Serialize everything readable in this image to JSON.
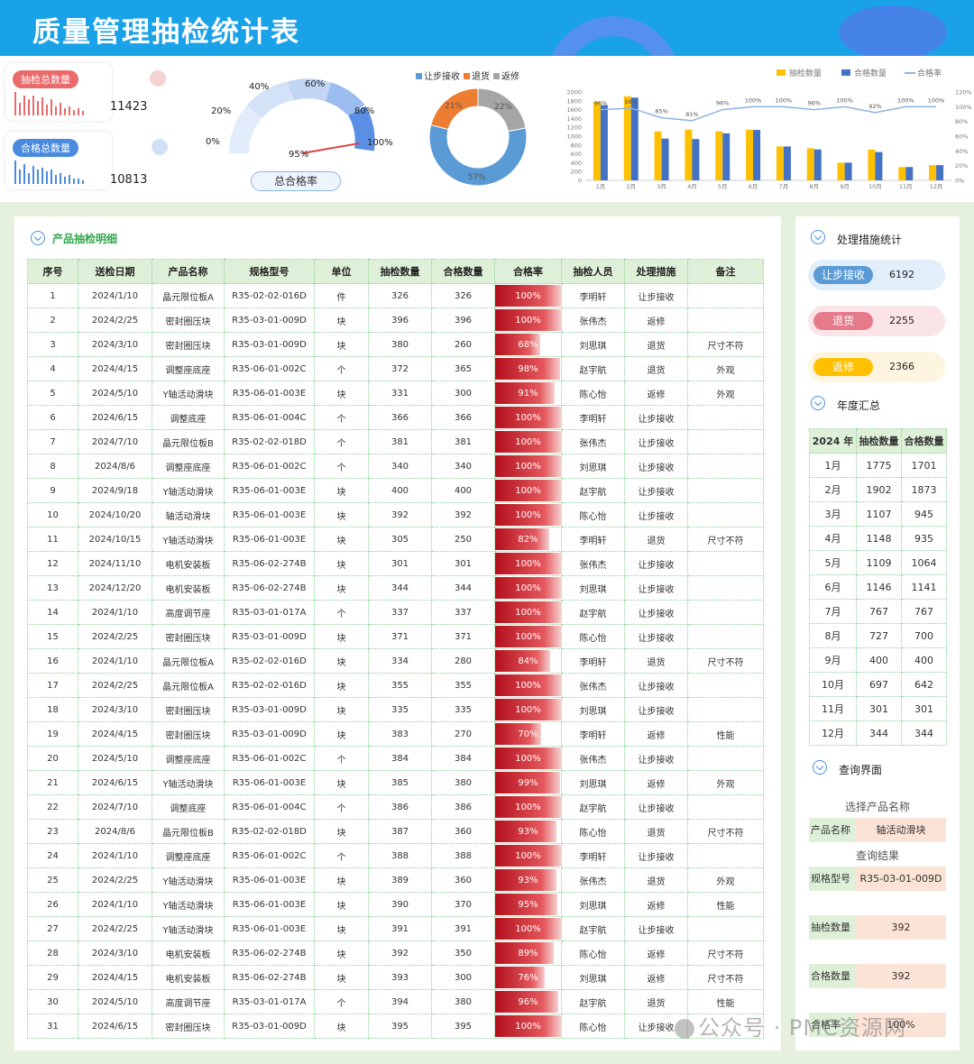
{
  "title": "质量管理抽检统计表",
  "kpis": {
    "inspected": {
      "label": "抽检总数量",
      "value": "11423",
      "color": "#e96b6b"
    },
    "qualified": {
      "label": "合格总数量",
      "value": "10813",
      "color": "#4a8be0"
    }
  },
  "gauge": {
    "title": "总合格率",
    "value_label": "95%",
    "value_fraction": 0.95,
    "ticks": [
      "0%",
      "20%",
      "40%",
      "60%",
      "80%",
      "100%"
    ]
  },
  "donut": {
    "legend": [
      "让步接收",
      "退货",
      "返修"
    ],
    "colors": [
      "#5b9bd5",
      "#ed7d31",
      "#a5a5a5"
    ],
    "chart_data": {
      "type": "pie",
      "categories": [
        "让步接收",
        "退货",
        "返修"
      ],
      "values": [
        57,
        21,
        22
      ],
      "labels": [
        "57%",
        "21%",
        "22%"
      ]
    }
  },
  "combo": {
    "legend": [
      "抽检数量",
      "合格数量",
      "合格率"
    ],
    "colors": {
      "inspected": "#ffc000",
      "qualified": "#4472c4",
      "rate": "#8db4e2"
    },
    "y_ticks": [
      "0",
      "200",
      "400",
      "600",
      "800",
      "1000",
      "1200",
      "1400",
      "1600",
      "1800",
      "2000"
    ],
    "y2_ticks": [
      "0%",
      "20%",
      "40%",
      "60%",
      "80%",
      "100%",
      "120%"
    ],
    "chart_data": {
      "type": "bar",
      "categories": [
        "1月",
        "2月",
        "3月",
        "4月",
        "5月",
        "6月",
        "7月",
        "8月",
        "9月",
        "10月",
        "11月",
        "12月"
      ],
      "series": [
        {
          "name": "抽检数量",
          "values": [
            1775,
            1902,
            1107,
            1148,
            1109,
            1146,
            767,
            727,
            400,
            697,
            301,
            344
          ]
        },
        {
          "name": "合格数量",
          "values": [
            1701,
            1873,
            945,
            935,
            1064,
            1141,
            767,
            700,
            400,
            642,
            301,
            344
          ]
        },
        {
          "name": "合格率",
          "values": [
            96,
            98,
            85,
            81,
            96,
            100,
            100,
            96,
            100,
            92,
            100,
            100
          ]
        }
      ],
      "rate_labels": [
        "96%",
        "98%",
        "85%",
        "81%",
        "96%",
        "100%",
        "100%",
        "96%",
        "100%",
        "92%",
        "100%",
        "100%"
      ],
      "ylim": [
        0,
        2000
      ],
      "y2lim": [
        0,
        120
      ]
    }
  },
  "detail": {
    "title": "产品抽检明细",
    "columns": [
      "序号",
      "送检日期",
      "产品名称",
      "规格型号",
      "单位",
      "抽检数量",
      "合格数量",
      "合格率",
      "抽检人员",
      "处理措施",
      "备注"
    ],
    "rows": [
      [
        "1",
        "2024/1/10",
        "晶元限位板A",
        "R35-02-02-016D",
        "件",
        "326",
        "326",
        "100%",
        "李明轩",
        "让步接收",
        ""
      ],
      [
        "2",
        "2024/2/25",
        "密封圈压块",
        "R35-03-01-009D",
        "块",
        "396",
        "396",
        "100%",
        "张伟杰",
        "返修",
        ""
      ],
      [
        "3",
        "2024/3/10",
        "密封圈压块",
        "R35-03-01-009D",
        "块",
        "380",
        "260",
        "68%",
        "刘思琪",
        "退货",
        "尺寸不符"
      ],
      [
        "4",
        "2024/4/15",
        "调整座底座",
        "R35-06-01-002C",
        "个",
        "372",
        "365",
        "98%",
        "赵宇航",
        "退货",
        "外观"
      ],
      [
        "5",
        "2024/5/10",
        "Y轴活动滑块",
        "R35-06-01-003E",
        "块",
        "331",
        "300",
        "91%",
        "陈心怡",
        "返修",
        "外观"
      ],
      [
        "6",
        "2024/6/15",
        "调整底座",
        "R35-06-01-004C",
        "个",
        "366",
        "366",
        "100%",
        "李明轩",
        "让步接收",
        ""
      ],
      [
        "7",
        "2024/7/10",
        "晶元限位板B",
        "R35-02-02-018D",
        "个",
        "381",
        "381",
        "100%",
        "张伟杰",
        "让步接收",
        ""
      ],
      [
        "8",
        "2024/8/6",
        "调整座底座",
        "R35-06-01-002C",
        "个",
        "340",
        "340",
        "100%",
        "刘思琪",
        "让步接收",
        ""
      ],
      [
        "9",
        "2024/9/18",
        "Y轴活动滑块",
        "R35-06-01-003E",
        "块",
        "400",
        "400",
        "100%",
        "赵宇航",
        "让步接收",
        ""
      ],
      [
        "10",
        "2024/10/20",
        "轴活动滑块",
        "R35-06-01-003E",
        "块",
        "392",
        "392",
        "100%",
        "陈心怡",
        "让步接收",
        ""
      ],
      [
        "11",
        "2024/10/15",
        "Y轴活动滑块",
        "R35-06-01-003E",
        "块",
        "305",
        "250",
        "82%",
        "李明轩",
        "退货",
        "尺寸不符"
      ],
      [
        "12",
        "2024/11/10",
        "电机安装板",
        "R35-06-02-274B",
        "块",
        "301",
        "301",
        "100%",
        "张伟杰",
        "让步接收",
        ""
      ],
      [
        "13",
        "2024/12/20",
        "电机安装板",
        "R35-06-02-274B",
        "块",
        "344",
        "344",
        "100%",
        "刘思琪",
        "让步接收",
        ""
      ],
      [
        "14",
        "2024/1/10",
        "高度调节座",
        "R35-03-01-017A",
        "个",
        "337",
        "337",
        "100%",
        "赵宇航",
        "让步接收",
        ""
      ],
      [
        "15",
        "2024/2/25",
        "密封圈压块",
        "R35-03-01-009D",
        "块",
        "371",
        "371",
        "100%",
        "陈心怡",
        "让步接收",
        ""
      ],
      [
        "16",
        "2024/1/10",
        "晶元限位板A",
        "R35-02-02-016D",
        "块",
        "334",
        "280",
        "84%",
        "李明轩",
        "退货",
        "尺寸不符"
      ],
      [
        "17",
        "2024/2/25",
        "晶元限位板A",
        "R35-02-02-016D",
        "块",
        "355",
        "355",
        "100%",
        "张伟杰",
        "让步接收",
        ""
      ],
      [
        "18",
        "2024/3/10",
        "密封圈压块",
        "R35-03-01-009D",
        "块",
        "335",
        "335",
        "100%",
        "刘思琪",
        "让步接收",
        ""
      ],
      [
        "19",
        "2024/4/15",
        "密封圈压块",
        "R35-03-01-009D",
        "块",
        "383",
        "270",
        "70%",
        "李明轩",
        "返修",
        "性能"
      ],
      [
        "20",
        "2024/5/10",
        "调整座底座",
        "R35-06-01-002C",
        "个",
        "384",
        "384",
        "100%",
        "张伟杰",
        "让步接收",
        ""
      ],
      [
        "21",
        "2024/6/15",
        "Y轴活动滑块",
        "R35-06-01-003E",
        "块",
        "385",
        "380",
        "99%",
        "刘思琪",
        "返修",
        "外观"
      ],
      [
        "22",
        "2024/7/10",
        "调整底座",
        "R35-06-01-004C",
        "个",
        "386",
        "386",
        "100%",
        "赵宇航",
        "让步接收",
        ""
      ],
      [
        "23",
        "2024/8/6",
        "晶元限位板B",
        "R35-02-02-018D",
        "块",
        "387",
        "360",
        "93%",
        "陈心怡",
        "退货",
        "尺寸不符"
      ],
      [
        "24",
        "2024/1/10",
        "调整座底座",
        "R35-06-01-002C",
        "个",
        "388",
        "388",
        "100%",
        "李明轩",
        "让步接收",
        ""
      ],
      [
        "25",
        "2024/2/25",
        "Y轴活动滑块",
        "R35-06-01-003E",
        "块",
        "389",
        "360",
        "93%",
        "张伟杰",
        "退货",
        "外观"
      ],
      [
        "26",
        "2024/1/10",
        "Y轴活动滑块",
        "R35-06-01-003E",
        "块",
        "390",
        "370",
        "95%",
        "刘思琪",
        "返修",
        "性能"
      ],
      [
        "27",
        "2024/2/25",
        "Y轴活动滑块",
        "R35-06-01-003E",
        "块",
        "391",
        "391",
        "100%",
        "赵宇航",
        "让步接收",
        ""
      ],
      [
        "28",
        "2024/3/10",
        "电机安装板",
        "R35-06-02-274B",
        "块",
        "392",
        "350",
        "89%",
        "陈心怡",
        "返修",
        "尺寸不符"
      ],
      [
        "29",
        "2024/4/15",
        "电机安装板",
        "R35-06-02-274B",
        "块",
        "393",
        "300",
        "76%",
        "刘思琪",
        "返修",
        "尺寸不符"
      ],
      [
        "30",
        "2024/5/10",
        "高度调节座",
        "R35-03-01-017A",
        "个",
        "394",
        "380",
        "96%",
        "赵宇航",
        "退货",
        "性能"
      ],
      [
        "31",
        "2024/6/15",
        "密封圈压块",
        "R35-03-01-009D",
        "块",
        "395",
        "395",
        "100%",
        "陈心怡",
        "让步接收",
        ""
      ]
    ]
  },
  "measures": {
    "title": "处理措施统计",
    "items": [
      {
        "label": "让步接收",
        "value": "6192",
        "pill": "#5b9bd5",
        "bg": "#e3eefb"
      },
      {
        "label": "退货",
        "value": "2255",
        "pill": "#e57a8a",
        "bg": "#fbe4e8"
      },
      {
        "label": "返修",
        "value": "2366",
        "pill": "#ffc000",
        "bg": "#fdf5e0"
      }
    ]
  },
  "yearly": {
    "title": "年度汇总",
    "columns": [
      "2024 年",
      "抽检数量",
      "合格数量"
    ],
    "rows": [
      [
        "1月",
        "1775",
        "1701"
      ],
      [
        "2月",
        "1902",
        "1873"
      ],
      [
        "3月",
        "1107",
        "945"
      ],
      [
        "4月",
        "1148",
        "935"
      ],
      [
        "5月",
        "1109",
        "1064"
      ],
      [
        "6月",
        "1146",
        "1141"
      ],
      [
        "7月",
        "767",
        "767"
      ],
      [
        "8月",
        "727",
        "700"
      ],
      [
        "9月",
        "400",
        "400"
      ],
      [
        "10月",
        "697",
        "642"
      ],
      [
        "11月",
        "301",
        "301"
      ],
      [
        "12月",
        "344",
        "344"
      ]
    ]
  },
  "query": {
    "title": "查询界面",
    "select_caption": "选择产品名称",
    "product_label": "产品名称",
    "product_value": "轴活动滑块",
    "result_caption": "查询结果",
    "spec_label": "规格型号",
    "spec_value": "R35-03-01-009D",
    "inspected_label": "抽检数量",
    "inspected_value": "392",
    "qualified_label": "合格数量",
    "qualified_value": "392",
    "rate_label": "合格率",
    "rate_value": "100%"
  },
  "watermark": "公众号 · PMC资源网"
}
